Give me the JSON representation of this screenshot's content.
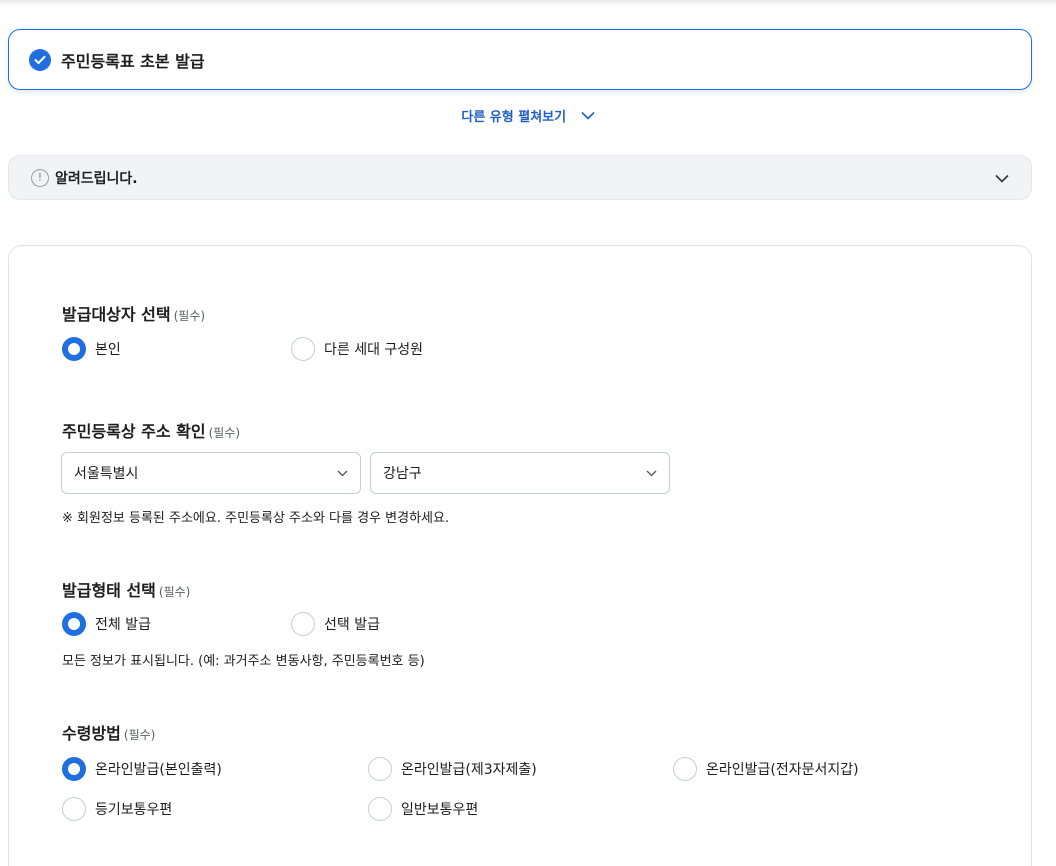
{
  "selected_type": {
    "title": "주민등록표 초본 발급"
  },
  "other_types_label": "다른 유형 펼쳐보기",
  "notice": {
    "label": "알려드립니다."
  },
  "sections": {
    "target": {
      "title": "발급대상자 선택",
      "required": "(필수)",
      "options": [
        {
          "label": "본인",
          "selected": true
        },
        {
          "label": "다른 세대 구성원",
          "selected": false
        }
      ]
    },
    "address": {
      "title": "주민등록상 주소 확인",
      "required": "(필수)",
      "city": "서울특별시",
      "district": "강남구",
      "note": "※ 회원정보 등록된 주소에요. 주민등록상 주소와 다를 경우 변경하세요."
    },
    "issue_form": {
      "title": "발급형태 선택",
      "required": "(필수)",
      "options": [
        {
          "label": "전체 발급",
          "selected": true
        },
        {
          "label": "선택 발급",
          "selected": false
        }
      ],
      "note": "모든 정보가 표시됩니다. (예: 과거주소 변동사항, 주민등록번호 등)"
    },
    "receive": {
      "title": "수령방법",
      "required": "(필수)",
      "options": [
        {
          "label": "온라인발급(본인출력)",
          "selected": true
        },
        {
          "label": "온라인발급(제3자제출)",
          "selected": false
        },
        {
          "label": "온라인발급(전자문서지갑)",
          "selected": false
        },
        {
          "label": "등기보통우편",
          "selected": false
        },
        {
          "label": "일반보통우편",
          "selected": false
        }
      ]
    }
  },
  "colors": {
    "accent": "#1f6fe0",
    "link": "#1f5fc4"
  }
}
